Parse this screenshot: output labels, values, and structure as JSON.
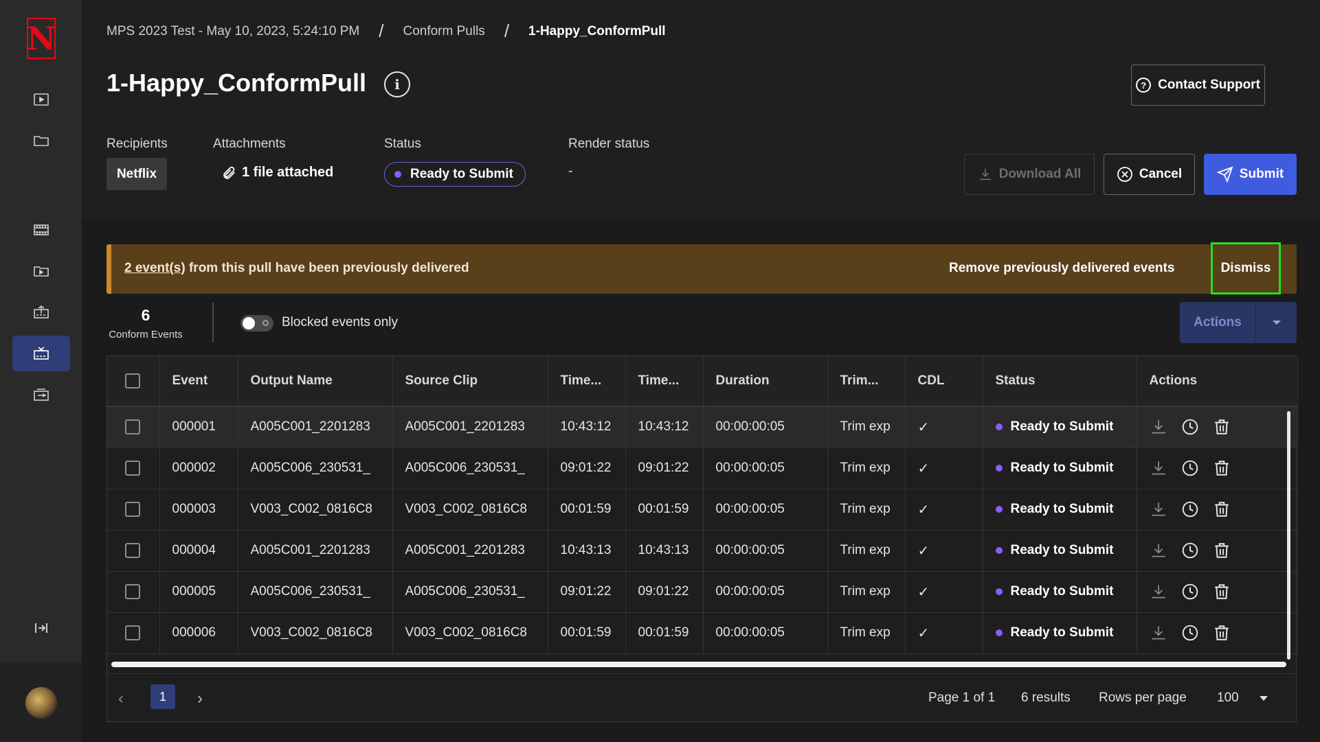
{
  "sidebar": {
    "logo_letter": "N",
    "icons": [
      "play-square-icon",
      "folder-icon",
      "film-strip-icon",
      "play-folder-icon",
      "upload-tray-icon",
      "conform-pull-icon",
      "export-box-icon",
      "collapse-icon"
    ],
    "active_item": "conform-pull-icon"
  },
  "breadcrumb": {
    "items": [
      "MPS 2023 Test - May 10, 2023, 5:24:10 PM",
      "Conform Pulls",
      "1-Happy_ConformPull"
    ],
    "separator": "/"
  },
  "page": {
    "title": "1-Happy_ConformPull"
  },
  "header": {
    "contact_support_label": "Contact Support",
    "recipients_label": "Recipients",
    "recipient": "Netflix",
    "attachments_label": "Attachments",
    "attachments_value": "1 file attached",
    "status_label": "Status",
    "status_value": "Ready to Submit",
    "render_status_label": "Render status",
    "render_status_value": "-",
    "download_all_label": "Download All",
    "cancel_label": "Cancel",
    "submit_label": "Submit"
  },
  "banner": {
    "link_text": "2 event(s)",
    "message": "from this pull have been previously delivered",
    "remove_label": "Remove previously delivered events",
    "dismiss_label": "Dismiss"
  },
  "toolbar": {
    "count": "6",
    "count_label": "Conform Events",
    "toggle_label": "Blocked events only",
    "actions_label": "Actions"
  },
  "table": {
    "columns": [
      "Event",
      "Output Name",
      "Source Clip",
      "Time...",
      "Time...",
      "Duration",
      "Trim...",
      "CDL",
      "Status",
      "Actions"
    ],
    "rows": [
      {
        "event": "000001",
        "output": "A005C001_2201283",
        "source": "A005C001_2201283",
        "t1": "10:43:12",
        "t2": "10:43:12",
        "duration": "00:00:00:05",
        "trim": "Trim exp",
        "cdl": "✓",
        "status": "Ready to Submit"
      },
      {
        "event": "000002",
        "output": "A005C006_230531_",
        "source": "A005C006_230531_",
        "t1": "09:01:22",
        "t2": "09:01:22",
        "duration": "00:00:00:05",
        "trim": "Trim exp",
        "cdl": "✓",
        "status": "Ready to Submit"
      },
      {
        "event": "000003",
        "output": "V003_C002_0816C8",
        "source": "V003_C002_0816C8",
        "t1": "00:01:59",
        "t2": "00:01:59",
        "duration": "00:00:00:05",
        "trim": "Trim exp",
        "cdl": "✓",
        "status": "Ready to Submit"
      },
      {
        "event": "000004",
        "output": "A005C001_2201283",
        "source": "A005C001_2201283",
        "t1": "10:43:13",
        "t2": "10:43:13",
        "duration": "00:00:00:05",
        "trim": "Trim exp",
        "cdl": "✓",
        "status": "Ready to Submit"
      },
      {
        "event": "000005",
        "output": "A005C006_230531_",
        "source": "A005C006_230531_",
        "t1": "09:01:22",
        "t2": "09:01:22",
        "duration": "00:00:00:05",
        "trim": "Trim exp",
        "cdl": "✓",
        "status": "Ready to Submit"
      },
      {
        "event": "000006",
        "output": "V003_C002_0816C8",
        "source": "V003_C002_0816C8",
        "t1": "00:01:59",
        "t2": "00:01:59",
        "duration": "00:00:00:05",
        "trim": "Trim exp",
        "cdl": "✓",
        "status": "Ready to Submit"
      }
    ],
    "row_action_icons": [
      "download-icon",
      "history-icon",
      "trash-icon"
    ]
  },
  "pagination": {
    "current_page": "1",
    "page_info": "Page 1 of 1",
    "results": "6 results",
    "rows_per_page_label": "Rows per page",
    "rows_per_page_value": "100"
  },
  "colors": {
    "accent": "#3f5be0",
    "status_dot": "#8b5cf6",
    "banner_bg": "#5a3f1b",
    "highlight": "#22e11e",
    "brand": "#e50914"
  }
}
